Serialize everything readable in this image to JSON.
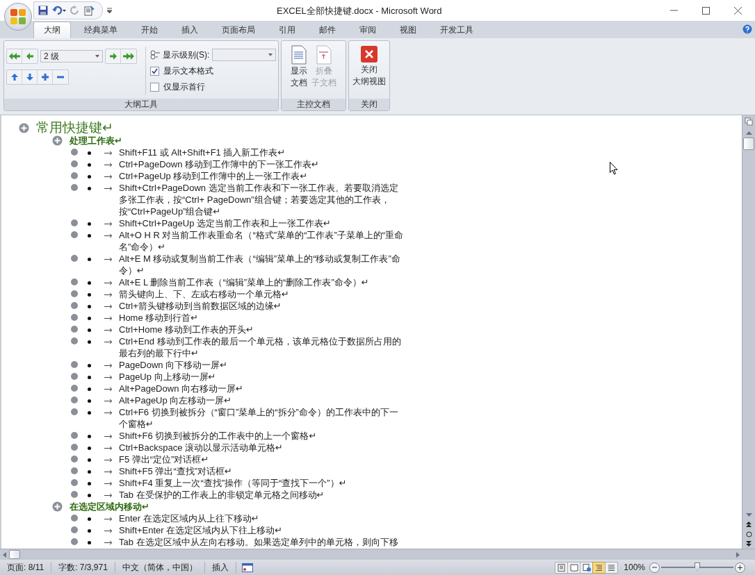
{
  "window": {
    "title": "EXCEL全部快捷键.docx - Microsoft Word"
  },
  "tabs": [
    {
      "label": "大纲",
      "selected": true
    },
    {
      "label": "经典菜单",
      "selected": false
    },
    {
      "label": "开始",
      "selected": false
    },
    {
      "label": "插入",
      "selected": false
    },
    {
      "label": "页面布局",
      "selected": false
    },
    {
      "label": "引用",
      "selected": false
    },
    {
      "label": "邮件",
      "selected": false
    },
    {
      "label": "审阅",
      "selected": false
    },
    {
      "label": "视图",
      "selected": false
    },
    {
      "label": "开发工具",
      "selected": false
    }
  ],
  "outline_tools": {
    "level_select": "2 级",
    "show_level_label": "显示级别(S):",
    "show_formatting": {
      "label": "显示文本格式",
      "checked": true
    },
    "first_line_only": {
      "label": "仅显示首行",
      "checked": false
    },
    "group_label": "大纲工具"
  },
  "master_document": {
    "buttons": [
      {
        "label_lines": [
          "显示",
          "文档"
        ],
        "disabled": false
      },
      {
        "label_lines": [
          "折叠",
          "子文档"
        ],
        "disabled": true
      }
    ],
    "group_label": "主控文档"
  },
  "close_group": {
    "button_lines": [
      "关闭",
      "大纲视图"
    ],
    "group_label": "关闭"
  },
  "outline": [
    {
      "kind": "heading1",
      "text": "常用快捷键↵",
      "children": [
        {
          "kind": "heading2",
          "text": "处理工作表↵",
          "children": [
            {
              "kind": "item",
              "text": "Shift+F11 或 Alt+Shift+F1 插入新工作表↵"
            },
            {
              "kind": "item",
              "text": "Ctrl+PageDown 移动到工作簿中的下一张工作表↵"
            },
            {
              "kind": "item",
              "text": "Ctrl+PageUp 移动到工作簿中的上一张工作表↵"
            },
            {
              "kind": "item",
              "text": "Shift+Ctrl+PageDown 选定当前工作表和下一张工作表。若要取消选定多张工作表，按“Ctrl+ PageDown”组合键；若要选定其他的工作表，按“Ctrl+PageUp”组合键↵"
            },
            {
              "kind": "item",
              "text": "Shift+Ctrl+PageUp 选定当前工作表和上一张工作表↵"
            },
            {
              "kind": "item",
              "text": "Alt+O H R 对当前工作表重命名（“格式”菜单的“工作表”子菜单上的“重命名”命令）↵"
            },
            {
              "kind": "item",
              "text": "Alt+E M 移动或复制当前工作表（“编辑”菜单上的“移动或复制工作表”命令）↵"
            },
            {
              "kind": "item",
              "text": "Alt+E L 删除当前工作表（“编辑”菜单上的“删除工作表”命令）↵"
            },
            {
              "kind": "item",
              "text": "箭头键向上、下、左或右移动一个单元格↵"
            },
            {
              "kind": "item",
              "text": "Ctrl+箭头键移动到当前数据区域的边缘↵"
            },
            {
              "kind": "item",
              "text": "Home 移动到行首↵"
            },
            {
              "kind": "item",
              "text": "Ctrl+Home 移动到工作表的开头↵"
            },
            {
              "kind": "item",
              "text": "Ctrl+End 移动到工作表的最后一个单元格，该单元格位于数据所占用的最右列的最下行中↵"
            },
            {
              "kind": "item",
              "text": "PageDown 向下移动一屏↵"
            },
            {
              "kind": "item",
              "text": "PageUp 向上移动一屏↵"
            },
            {
              "kind": "item",
              "text": "Alt+PageDown 向右移动一屏↵"
            },
            {
              "kind": "item",
              "text": "Alt+PageUp 向左移动一屏↵"
            },
            {
              "kind": "item",
              "text": "Ctrl+F6 切换到被拆分（“窗口”菜单上的“拆分”命令）的工作表中的下一个窗格↵"
            },
            {
              "kind": "item",
              "text": "Shift+F6 切换到被拆分的工作表中的上一个窗格↵"
            },
            {
              "kind": "item",
              "text": "Ctrl+Backspace 滚动以显示活动单元格↵"
            },
            {
              "kind": "item",
              "text": "F5 弹出“定位”对话框↵"
            },
            {
              "kind": "item",
              "text": "Shift+F5 弹出“查找”对话框↵"
            },
            {
              "kind": "item",
              "text": "Shift+F4 重复上一次“查找”操作（等同于“查找下一个”）↵"
            },
            {
              "kind": "item",
              "text": "Tab 在受保护的工作表上的非锁定单元格之间移动↵"
            }
          ]
        },
        {
          "kind": "heading2",
          "text": "在选定区域内移动↵",
          "children": [
            {
              "kind": "item",
              "text": "Enter 在选定区域内从上往下移动↵"
            },
            {
              "kind": "item",
              "text": "Shift+Enter 在选定区域内从下往上移动↵"
            },
            {
              "kind": "item",
              "text": "Tab 在选定区域中从左向右移动。如果选定单列中的单元格，则向下移"
            }
          ]
        }
      ]
    }
  ],
  "status_bar": {
    "page": "页面: 8/11",
    "words": "字数: 7/3,971",
    "language": "中文（简体，中国）",
    "mode": "插入",
    "views": [
      {
        "kind": "print_layout",
        "selected": false
      },
      {
        "kind": "reading",
        "selected": false
      },
      {
        "kind": "web",
        "selected": false
      },
      {
        "kind": "outline",
        "selected": true
      },
      {
        "kind": "draft",
        "selected": false
      }
    ],
    "zoom": {
      "reading": "100%",
      "level": 0.5
    }
  }
}
